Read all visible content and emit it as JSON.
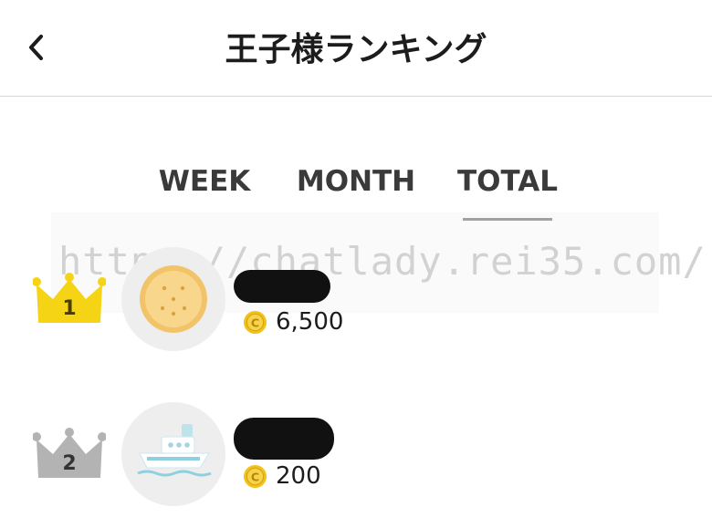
{
  "header": {
    "title": "王子様ランキング"
  },
  "tabs": [
    {
      "label": "WEEK",
      "selected": false
    },
    {
      "label": "MONTH",
      "selected": false
    },
    {
      "label": "TOTAL",
      "selected": true
    }
  ],
  "watermark": "https://chatlady.rei35.com/",
  "ranking": [
    {
      "rank": "1",
      "avatar_icon": "cracker-icon",
      "name_redacted": true,
      "score": "6,500",
      "crown_color": "#f5d415"
    },
    {
      "rank": "2",
      "avatar_icon": "ship-icon",
      "name_redacted": true,
      "score": "200",
      "crown_color": "#b3b3b3"
    }
  ],
  "colors": {
    "accent_text": "#3a3a3a",
    "coin": "#f2c21b",
    "divider": "#d7d7d7"
  }
}
